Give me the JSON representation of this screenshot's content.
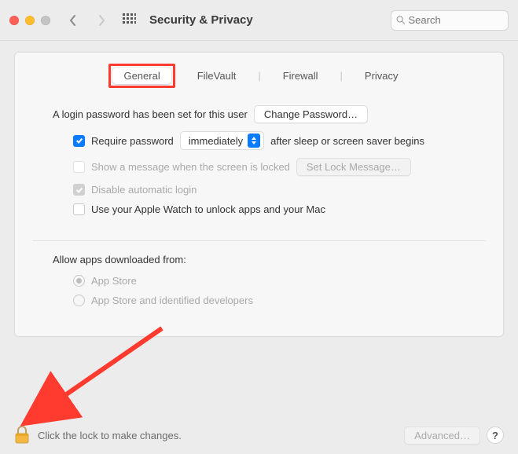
{
  "toolbar": {
    "title": "Security & Privacy",
    "search_placeholder": "Search"
  },
  "tabs": {
    "general": "General",
    "filevault": "FileVault",
    "firewall": "Firewall",
    "privacy": "Privacy"
  },
  "login": {
    "text": "A login password has been set for this user",
    "change_btn": "Change Password…",
    "require_pw_label_pre": "Require password",
    "require_pw_select": "immediately",
    "require_pw_label_post": "after sleep or screen saver begins",
    "show_msg_label": "Show a message when the screen is locked",
    "set_lock_msg_btn": "Set Lock Message…",
    "disable_auto_login": "Disable automatic login",
    "apple_watch": "Use your Apple Watch to unlock apps and your Mac"
  },
  "apps": {
    "heading": "Allow apps downloaded from:",
    "opt1": "App Store",
    "opt2": "App Store and identified developers"
  },
  "footer": {
    "lock_text": "Click the lock to make changes.",
    "advanced_btn": "Advanced…",
    "help": "?"
  }
}
